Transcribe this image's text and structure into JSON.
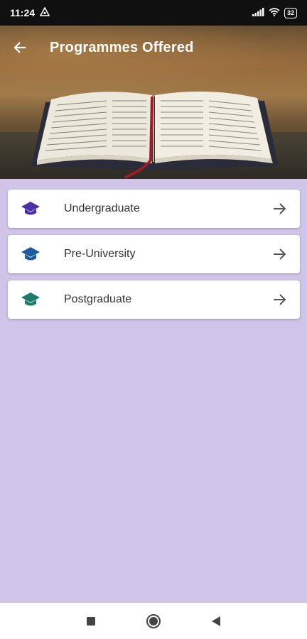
{
  "status_bar": {
    "time": "11:24",
    "battery": "32"
  },
  "toolbar": {
    "title": "Programmes Offered"
  },
  "programmes": [
    {
      "label": "Undergraduate",
      "icon": "graduation-cap-icon",
      "color": "#4a2fa8"
    },
    {
      "label": "Pre-University",
      "icon": "graduation-cap-icon",
      "color": "#1f5b9e"
    },
    {
      "label": "Postgraduate",
      "icon": "graduation-cap-icon",
      "color": "#1c7a68"
    }
  ],
  "colors": {
    "background": "#d0c5e8",
    "status_bar": "#101010"
  }
}
